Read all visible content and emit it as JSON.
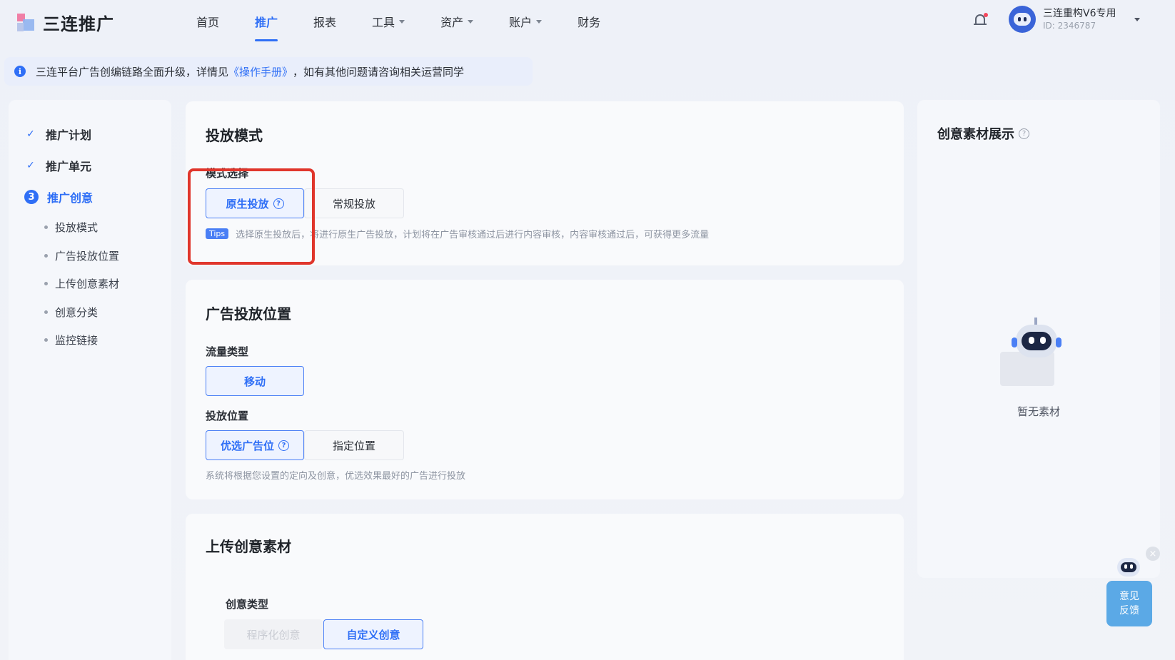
{
  "app": {
    "logo_text": "三连推广"
  },
  "nav": {
    "items": [
      {
        "label": "首页"
      },
      {
        "label": "推广"
      },
      {
        "label": "报表"
      },
      {
        "label": "工具"
      },
      {
        "label": "资产"
      },
      {
        "label": "账户"
      },
      {
        "label": "财务"
      }
    ],
    "active_index": 1
  },
  "user": {
    "name": "三连重构V6专用",
    "id": "ID: 2346787"
  },
  "notice": {
    "text_before": "三连平台广告创编链路全面升级，详情见",
    "link": "《操作手册》",
    "text_after": "，如有其他问题请咨询相关运营同学"
  },
  "sidebar": {
    "steps": [
      {
        "label": "推广计划",
        "state": "done"
      },
      {
        "label": "推广单元",
        "state": "done"
      },
      {
        "label": "推广创意",
        "state": "current",
        "number": "3"
      }
    ],
    "sub_items": [
      {
        "label": "投放模式"
      },
      {
        "label": "广告投放位置"
      },
      {
        "label": "上传创意素材"
      },
      {
        "label": "创意分类"
      },
      {
        "label": "监控链接"
      }
    ]
  },
  "delivery_mode": {
    "title": "投放模式",
    "field_label": "模式选择",
    "options": [
      {
        "label": "原生投放",
        "selected": true,
        "has_help": true
      },
      {
        "label": "常规投放",
        "selected": false
      }
    ],
    "tips_badge": "Tips",
    "tips_text": "选择原生投放后，将进行原生广告投放，计划将在广告审核通过后进行内容审核，内容审核通过后，可获得更多流量"
  },
  "placement": {
    "title": "广告投放位置",
    "traffic_label": "流量类型",
    "traffic_option": "移动",
    "position_label": "投放位置",
    "position_options": [
      {
        "label": "优选广告位",
        "selected": true,
        "has_help": true
      },
      {
        "label": "指定位置",
        "selected": false
      }
    ],
    "hint": "系统将根据您设置的定向及创意，优选效果最好的广告进行投放"
  },
  "upload": {
    "title": "上传创意素材",
    "type_label": "创意类型",
    "type_options": [
      {
        "label": "程序化创意",
        "selected": false,
        "disabled": true
      },
      {
        "label": "自定义创意",
        "selected": true
      }
    ]
  },
  "preview": {
    "title": "创意素材展示",
    "empty_text": "暂无素材"
  },
  "feedback": {
    "line1": "意见",
    "line2": "反馈"
  },
  "colors": {
    "accent": "#2f6ff6",
    "highlight_box": "#e0362c",
    "feedback_bg": "#5ba9e6"
  }
}
